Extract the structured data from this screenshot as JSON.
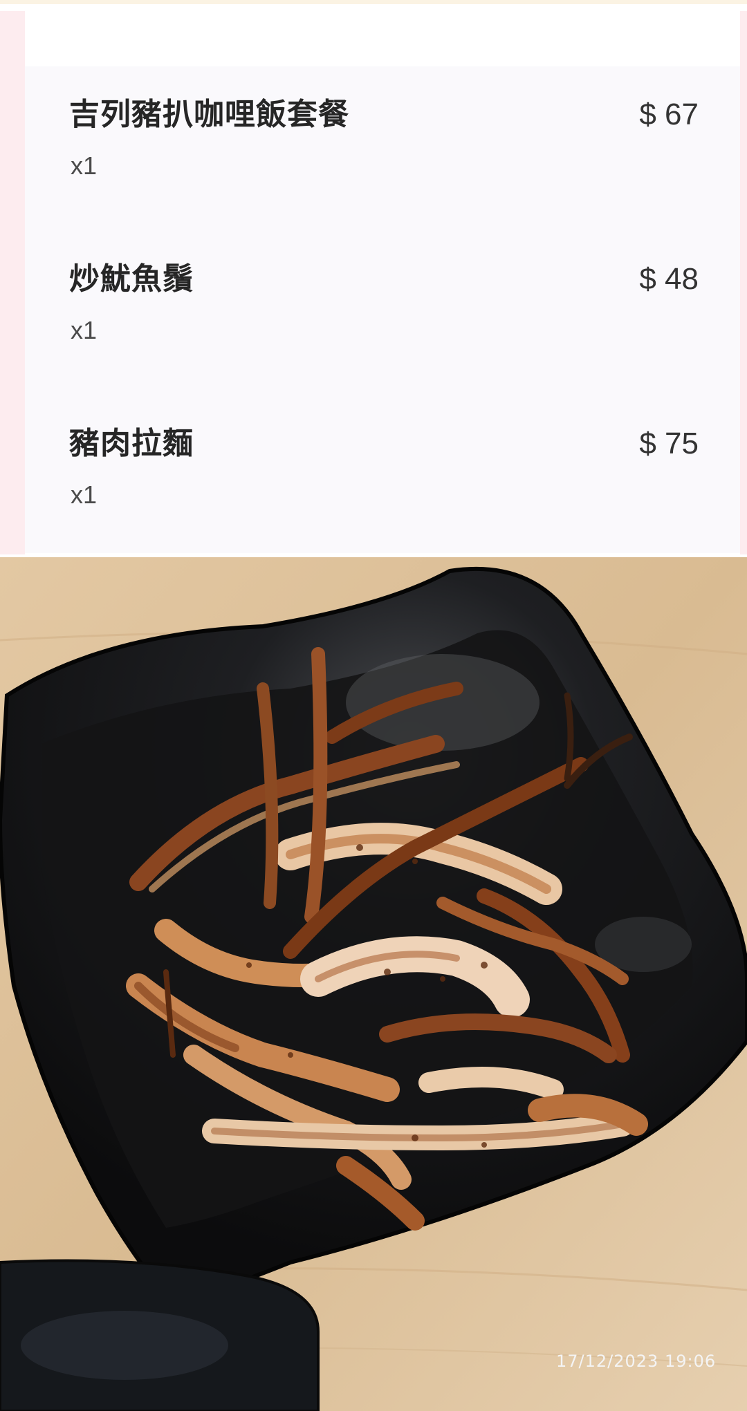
{
  "order": {
    "items": [
      {
        "name": "吉列豬扒咖哩飯套餐",
        "price": "$ 67",
        "qty": "x1"
      },
      {
        "name": "炒魷魚鬚",
        "price": "$ 48",
        "qty": "x1"
      },
      {
        "name": "豬肉拉麵",
        "price": "$ 75",
        "qty": "x1"
      }
    ]
  },
  "photo": {
    "subject": "stir-fried squid tentacles on black square dish",
    "timestamp": "17/12/2023 19:06"
  },
  "colors": {
    "card_background": "#faf9fc",
    "card_edge": "#fdecef",
    "text_primary": "#262626",
    "table_wood": "#dcbf98",
    "dish_black": "#151515",
    "squid_brown": "#8a4a24"
  }
}
